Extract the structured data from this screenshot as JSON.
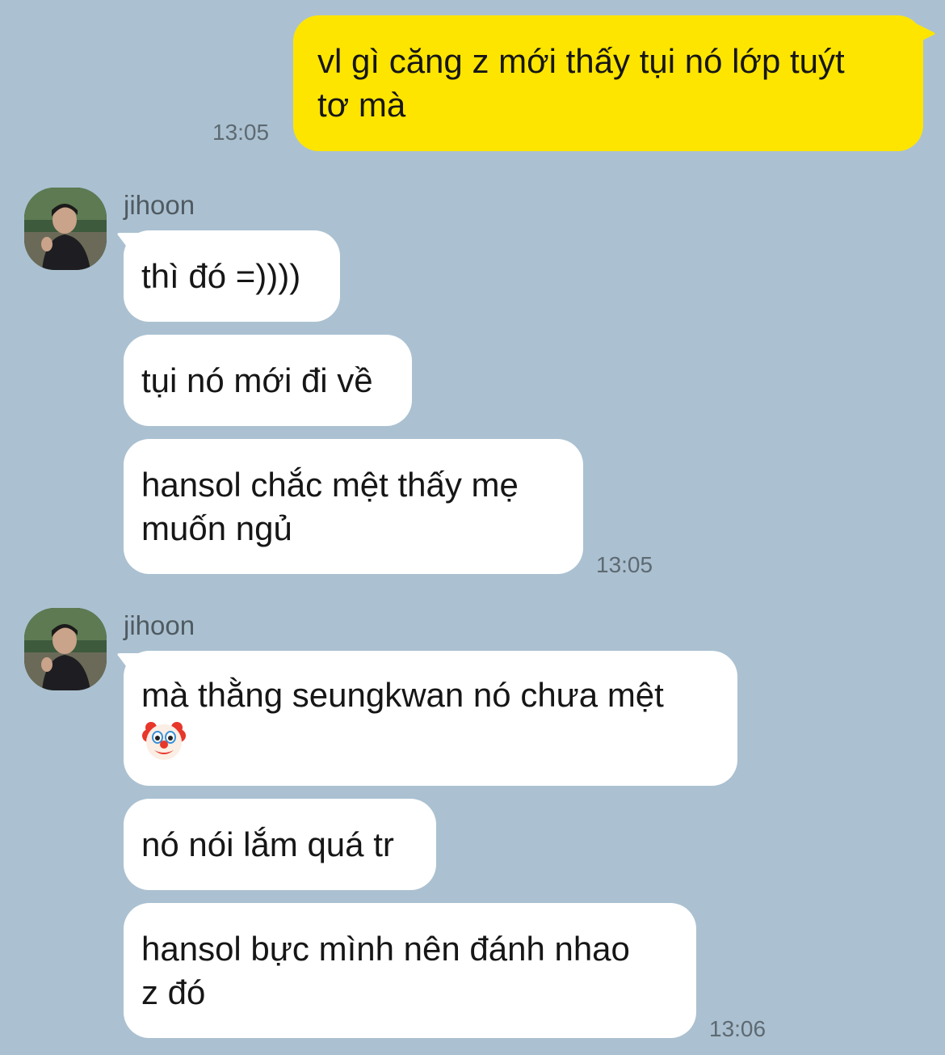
{
  "colors": {
    "background": "#abc1d1",
    "incoming_bubble": "#ffffff",
    "outgoing_bubble": "#fee500",
    "timestamp": "#5e6a72",
    "sender_name": "#4f5a61"
  },
  "messages": {
    "outgoing_1": {
      "line1": "vl gì căng z mới thấy tụi nó lớp tuýt",
      "line2": "tơ mà",
      "time": "13:05"
    },
    "group_1": {
      "sender": "jihoon",
      "avatar_icon": "profile-photo",
      "msg1": "thì đó =))))",
      "msg2": "tụi nó mới đi về",
      "msg3_line1": "hansol chắc mệt thấy mẹ",
      "msg3_line2": "muốn ngủ",
      "time": "13:05"
    },
    "group_2": {
      "sender": "jihoon",
      "avatar_icon": "profile-photo",
      "msg1_line1": "mà thằng seungkwan nó chưa mệt",
      "msg1_emoji": "clown-face-icon",
      "msg2": "nó nói lắm quá tr",
      "msg3_line1": "hansol bực mình nên đánh nhao",
      "msg3_line2": "z đó",
      "time": "13:06"
    }
  }
}
